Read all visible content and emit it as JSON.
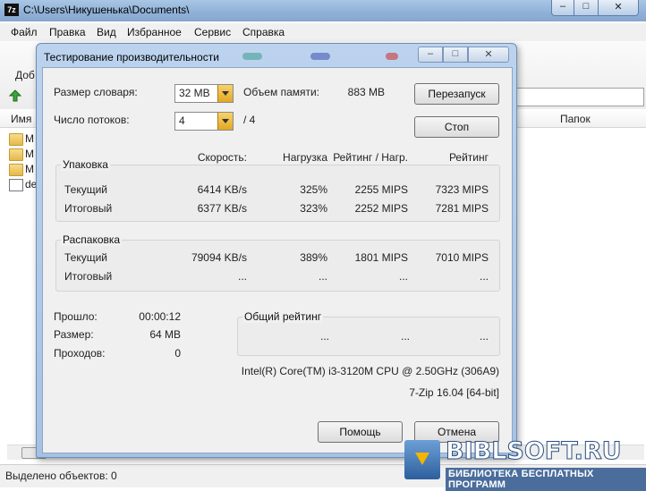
{
  "window": {
    "title": "C:\\Users\\Никушенька\\Documents\\",
    "app_icon": "7z",
    "min": "–",
    "max": "□",
    "close": "✕"
  },
  "menu": [
    "Файл",
    "Правка",
    "Вид",
    "Избранное",
    "Сервис",
    "Справка"
  ],
  "toolbar": {
    "add_label": "Доб"
  },
  "list": {
    "col_name": "Имя",
    "col_folders": "Папок",
    "rows": [
      {
        "name": "M",
        "icon": "folder-icon"
      },
      {
        "name": "M",
        "icon": "folder-icon"
      },
      {
        "name": "M",
        "icon": "folder-icon"
      },
      {
        "name": "de",
        "icon": "document-icon"
      }
    ]
  },
  "status": {
    "text": "Выделено объектов: 0"
  },
  "dialog": {
    "title": "Тестирование производительности",
    "dict_label": "Размер словаря:",
    "dict_value": "32 MB",
    "memory_label": "Объем памяти:",
    "memory_value": "883 MB",
    "threads_label": "Число потоков:",
    "threads_value": "4",
    "threads_max": "/ 4",
    "restart_button": "Перезапуск",
    "stop_button": "Стоп",
    "col_speed": "Скорость:",
    "col_load": "Нагрузка",
    "col_rating_load": "Рейтинг / Нагр.",
    "col_rating": "Рейтинг",
    "packing": {
      "title": "Упаковка",
      "rows": [
        {
          "label": "Текущий",
          "speed": "6414 KB/s",
          "load": "325%",
          "rating_load": "2255 MIPS",
          "rating": "7323 MIPS"
        },
        {
          "label": "Итоговый",
          "speed": "6377 KB/s",
          "load": "323%",
          "rating_load": "2252 MIPS",
          "rating": "7281 MIPS"
        }
      ]
    },
    "unpacking": {
      "title": "Распаковка",
      "rows": [
        {
          "label": "Текущий",
          "speed": "79094 KB/s",
          "load": "389%",
          "rating_load": "1801 MIPS",
          "rating": "7010 MIPS"
        },
        {
          "label": "Итоговый",
          "speed": "...",
          "load": "...",
          "rating_load": "...",
          "rating": "..."
        }
      ]
    },
    "elapsed_label": "Прошло:",
    "elapsed_value": "00:00:12",
    "size_label": "Размер:",
    "size_value": "64 MB",
    "passes_label": "Проходов:",
    "passes_value": "0",
    "total_title": "Общий рейтинг",
    "total_values": [
      "...",
      "...",
      "..."
    ],
    "cpu": "Intel(R) Core(TM) i3-3120M CPU @ 2.50GHz (306A9)",
    "version": "7-Zip 16.04 [64-bit]",
    "help_button": "Помощь",
    "cancel_button": "Отмена"
  },
  "watermark": {
    "name": "BIBLSOFT.RU",
    "subtitle": "БИБЛИОТЕКА БЕСПЛАТНЫХ ПРОГРАММ"
  },
  "colors": {
    "title_bar": "#8fb0d6",
    "dialog_frame": "#a6c1e3",
    "combo_arrow": "#e3a724"
  }
}
